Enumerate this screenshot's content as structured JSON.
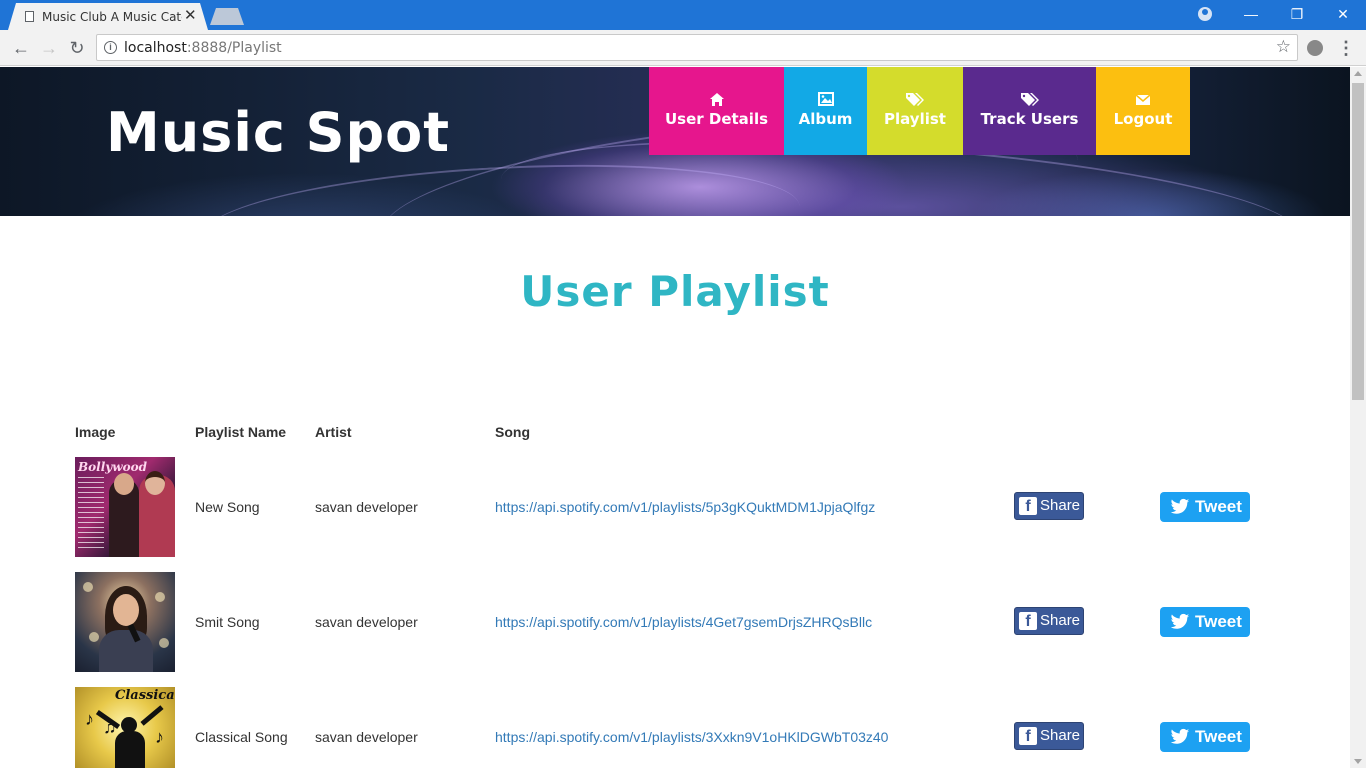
{
  "browser": {
    "tab_title": "Music Club A Music Cate",
    "tab_close": "✕",
    "url_host": "localhost",
    "url_rest": ":8888/Playlist",
    "win_minimize": "—",
    "win_restore": "❐",
    "win_close": "✕"
  },
  "header": {
    "brand": "Music Spot",
    "menu": [
      {
        "label": "User Details",
        "icon": "home-icon",
        "color": "#e6168d"
      },
      {
        "label": "Album",
        "icon": "picture-icon",
        "color": "#12a9e6"
      },
      {
        "label": "Playlist",
        "icon": "tags-icon",
        "color": "#d4dc2c"
      },
      {
        "label": "Track Users",
        "icon": "tag-icon",
        "color": "#5a2a8e"
      },
      {
        "label": "Logout",
        "icon": "envelope-icon",
        "color": "#fcbf10"
      }
    ]
  },
  "page": {
    "title": "User Playlist"
  },
  "table": {
    "headers": {
      "image": "Image",
      "playlist_name": "Playlist Name",
      "artist": "Artist",
      "song": "Song"
    },
    "rows": [
      {
        "name": "New Song",
        "artist": "savan developer",
        "song": "https://api.spotify.com/v1/playlists/5p3gKQuktMDM1JpjaQlfgz",
        "image_caption": "Bollywood",
        "share_label": "Share",
        "tweet_label": "Tweet"
      },
      {
        "name": "Smit Song",
        "artist": "savan developer",
        "song": "https://api.spotify.com/v1/playlists/4Get7gsemDrjsZHRQsBllc",
        "share_label": "Share",
        "tweet_label": "Tweet"
      },
      {
        "name": "Classical Song",
        "artist": "savan developer",
        "song": "https://api.spotify.com/v1/playlists/3Xxkn9V1oHKlDGWbT03z40",
        "image_caption": "Classical",
        "share_label": "Share",
        "tweet_label": "Tweet"
      }
    ]
  }
}
